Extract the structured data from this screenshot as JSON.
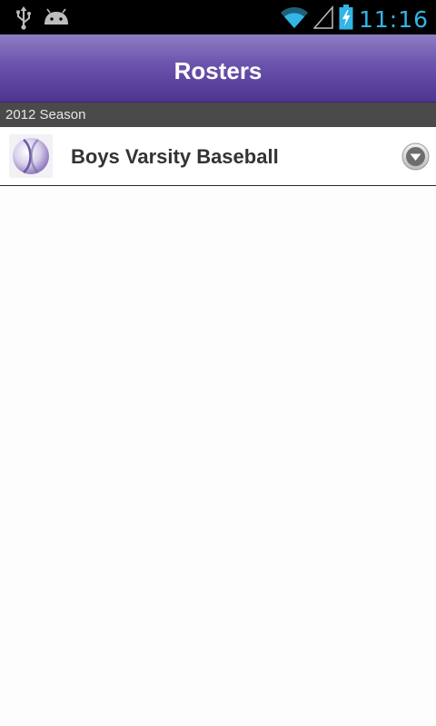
{
  "status_bar": {
    "time": "11:16",
    "left_icons": [
      "usb-icon",
      "android-debug-icon"
    ],
    "right_icons": [
      "wifi-icon",
      "cell-signal-icon",
      "battery-charging-icon"
    ],
    "accent_color": "#33b5e5"
  },
  "header": {
    "title": "Rosters",
    "gradient_top": "#8f7dc5",
    "gradient_bottom": "#4e3591"
  },
  "section": {
    "label": "2012 Season"
  },
  "rosters": [
    {
      "label": "Boys Varsity Baseball",
      "icon": "baseball-icon",
      "action_icon": "chevron-down-icon"
    }
  ]
}
